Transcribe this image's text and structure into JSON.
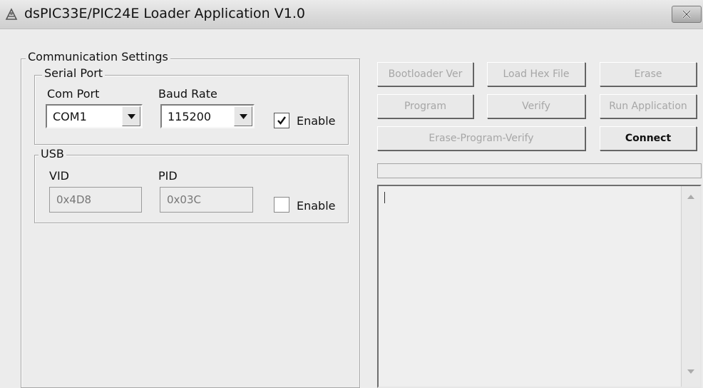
{
  "window": {
    "title": "dsPIC33E/PIC24E Loader Application V1.0"
  },
  "comm": {
    "legend": "Communication Settings",
    "serial": {
      "legend": "Serial Port",
      "com_label": "Com Port",
      "com_value": "COM1",
      "baud_label": "Baud Rate",
      "baud_value": "115200",
      "enable_label": "Enable",
      "enabled": true
    },
    "usb": {
      "legend": "USB",
      "vid_label": "VID",
      "vid_value": "0x4D8",
      "pid_label": "PID",
      "pid_value": "0x03C",
      "enable_label": "Enable",
      "enabled": false
    }
  },
  "buttons": {
    "bootloader_ver": "Bootloader Ver",
    "load_hex": "Load Hex File",
    "erase": "Erase",
    "program": "Program",
    "verify": "Verify",
    "run_app": "Run Application",
    "erase_program_verify": "Erase-Program-Verify",
    "connect": "Connect"
  },
  "colors": {
    "window_bg": "#ececec",
    "disabled_text": "#a6a6a6"
  }
}
